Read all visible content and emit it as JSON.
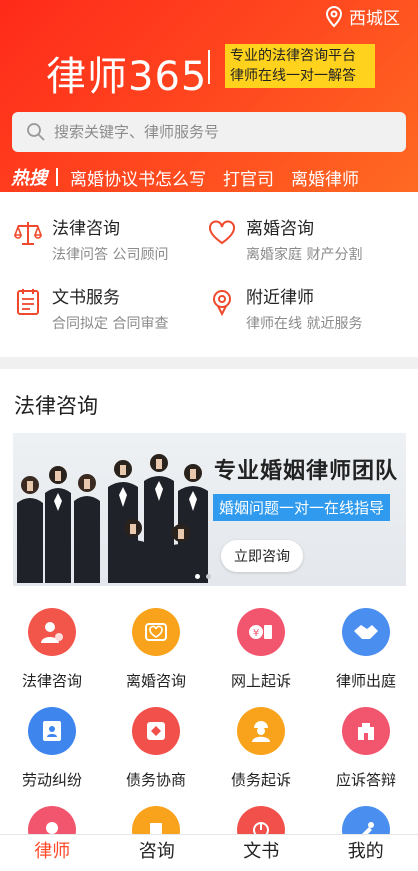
{
  "header": {
    "location": "西城区",
    "brand": "律师365",
    "slogan_line1": "专业的法律咨询平台",
    "slogan_line2": "律师在线一对一解答",
    "search_placeholder": "搜索关键字、律师服务号",
    "hot_label": "热搜",
    "hot_keywords": [
      "离婚协议书怎么写",
      "打官司",
      "离婚律师"
    ]
  },
  "services": [
    {
      "title": "法律咨询",
      "sub": "法律问答 公司顾问",
      "icon": "scales-icon"
    },
    {
      "title": "离婚咨询",
      "sub": "离婚家庭 财产分割",
      "icon": "heart-icon"
    },
    {
      "title": "文书服务",
      "sub": "合同拟定 合同审查",
      "icon": "document-icon"
    },
    {
      "title": "附近律师",
      "sub": "律师在线 就近服务",
      "icon": "location-pin-icon"
    }
  ],
  "section_title": "法律咨询",
  "banner": {
    "headline": "专业婚姻律师团队",
    "subline": "婚姻问题一对一在线指导",
    "button": "立即咨询"
  },
  "grid": [
    {
      "label": "法律咨询",
      "color": "#f2564a",
      "icon": "user-chat-icon"
    },
    {
      "label": "离婚咨询",
      "color": "#f9a21b",
      "icon": "heart-icon"
    },
    {
      "label": "网上起诉",
      "color": "#f2566e",
      "icon": "money-file-icon"
    },
    {
      "label": "律师出庭",
      "color": "#4a8ef0",
      "icon": "handshake-icon"
    },
    {
      "label": "劳动纠纷",
      "color": "#3e86ee",
      "icon": "id-card-icon"
    },
    {
      "label": "债务协商",
      "color": "#f2504a",
      "icon": "diamond-icon"
    },
    {
      "label": "债务起诉",
      "color": "#f9a21b",
      "icon": "worker-icon"
    },
    {
      "label": "应诉答辩",
      "color": "#f2566e",
      "icon": "building-icon"
    },
    {
      "label": "",
      "color": "#f2566e",
      "icon": "pin-icon"
    },
    {
      "label": "",
      "color": "#f9a21b",
      "icon": "book-icon"
    },
    {
      "label": "",
      "color": "#f2504a",
      "icon": "chart-icon"
    },
    {
      "label": "",
      "color": "#4a8ef0",
      "icon": "tools-icon"
    }
  ],
  "tabs": [
    {
      "label": "律师",
      "active": true
    },
    {
      "label": "咨询",
      "active": false
    },
    {
      "label": "文书",
      "active": false
    },
    {
      "label": "我的",
      "active": false
    }
  ],
  "colors": {
    "brand": "#ff3a1e",
    "active_tab": "#ff4a2a",
    "slogan_bg": "#ffd21e"
  }
}
